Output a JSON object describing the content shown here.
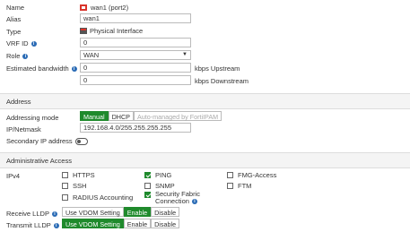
{
  "general": {
    "name_label": "Name",
    "name_value": "wan1 (port2)",
    "alias_label": "Alias",
    "alias_value": "wan1",
    "type_label": "Type",
    "type_value": "Physical Interface",
    "vrf_label": "VRF ID",
    "vrf_value": "0",
    "role_label": "Role",
    "role_value": "WAN",
    "bw_label": "Estimated bandwidth",
    "bw_up_value": "0",
    "bw_up_unit": "kbps Upstream",
    "bw_down_value": "0",
    "bw_down_unit": "kbps Downstream"
  },
  "address": {
    "section_title": "Address",
    "mode_label": "Addressing mode",
    "modes": [
      "Manual",
      "DHCP",
      "Auto-managed by FortiIPAM"
    ],
    "ip_label": "IP/Netmask",
    "ip_value": "192.168.4.0/255.255.255.255",
    "secondary_label": "Secondary IP address"
  },
  "admin": {
    "section_title": "Administrative Access",
    "ipv4_label": "IPv4",
    "options": {
      "https": "HTTPS",
      "ping": "PING",
      "fmg": "FMG-Access",
      "ssh": "SSH",
      "snmp": "SNMP",
      "ftm": "FTM",
      "radius": "RADIUS Accounting",
      "sfc_line1": "Security Fabric",
      "sfc_line2": "Connection"
    },
    "receive_lldp_label": "Receive LLDP",
    "transmit_lldp_label": "Transmit LLDP",
    "lldp_options": [
      "Use VDOM Setting",
      "Enable",
      "Disable"
    ]
  },
  "colors": {
    "accent": "#1f8a2c",
    "info": "#2a6bb5",
    "icon_red": "#d9342b"
  }
}
